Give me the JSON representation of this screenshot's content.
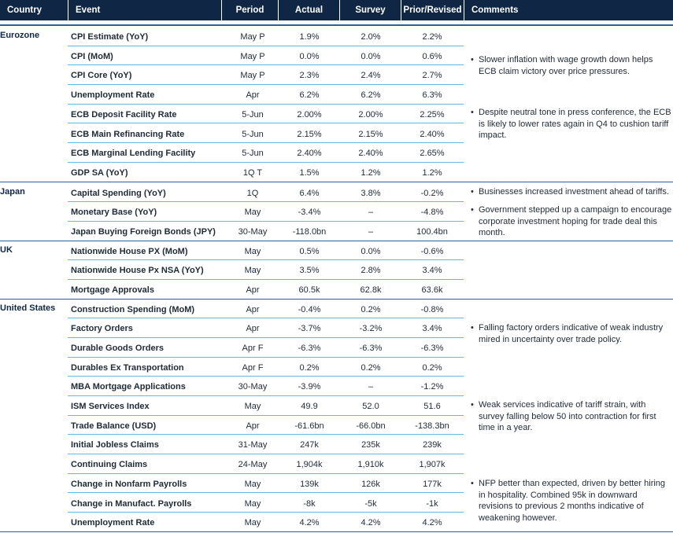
{
  "columns": {
    "country": "Country",
    "event": "Event",
    "period": "Period",
    "actual": "Actual",
    "survey": "Survey",
    "prior": "Prior/Revised",
    "comments": "Comments"
  },
  "bullet_glyph": "•",
  "colors": {
    "header_bg": "#0f2744",
    "row_separator": "#63b8dd",
    "block_border": "#2e5f98"
  },
  "blocks": [
    {
      "country": "Eurozone",
      "rows": [
        {
          "event": "CPI Estimate (YoY)",
          "period": "May P",
          "actual": "1.9%",
          "survey": "2.0%",
          "prior": "2.2%"
        },
        {
          "event": "CPI (MoM)",
          "period": "May P",
          "actual": "0.0%",
          "survey": "0.0%",
          "prior": "0.6%"
        },
        {
          "event": "CPI Core (YoY)",
          "period": "May P",
          "actual": "2.3%",
          "survey": "2.4%",
          "prior": "2.7%"
        },
        {
          "event": "Unemployment Rate",
          "period": "Apr",
          "actual": "6.2%",
          "survey": "6.2%",
          "prior": "6.3%"
        },
        {
          "event": "ECB Deposit Facility Rate",
          "period": "5-Jun",
          "actual": "2.00%",
          "survey": "2.00%",
          "prior": "2.25%"
        },
        {
          "event": "ECB Main Refinancing Rate",
          "period": "5-Jun",
          "actual": "2.15%",
          "survey": "2.15%",
          "prior": "2.40%"
        },
        {
          "event": "ECB Marginal Lending Facility",
          "period": "5-Jun",
          "actual": "2.40%",
          "survey": "2.40%",
          "prior": "2.65%"
        },
        {
          "event": "GDP SA (YoY)",
          "period": "1Q T",
          "actual": "1.5%",
          "survey": "1.2%",
          "prior": "1.2%"
        }
      ],
      "comments": [
        "Slower inflation with wage growth down helps ECB claim victory over price pressures.",
        "Despite neutral tone in press conference, the ECB is likely to lower rates again in Q4 to cushion tariff impact."
      ]
    },
    {
      "country": "Japan",
      "rows": [
        {
          "event": "Capital Spending (YoY)",
          "period": "1Q",
          "actual": "6.4%",
          "survey": "3.8%",
          "prior": "-0.2%"
        },
        {
          "event": "Monetary Base (YoY)",
          "period": "May",
          "actual": "-3.4%",
          "survey": "–",
          "prior": "-4.8%"
        },
        {
          "event": "Japan Buying Foreign Bonds (JPY)",
          "period": "30-May",
          "actual": "-118.0bn",
          "survey": "–",
          "prior": "100.4bn"
        }
      ],
      "comments": [
        "Businesses increased investment ahead of tariffs.",
        "Government stepped up a campaign to encourage corporate investment hoping for trade deal this month."
      ]
    },
    {
      "country": "UK",
      "rows": [
        {
          "event": "Nationwide House PX (MoM)",
          "period": "May",
          "actual": "0.5%",
          "survey": "0.0%",
          "prior": "-0.6%"
        },
        {
          "event": "Nationwide House Px NSA (YoY)",
          "period": "May",
          "actual": "3.5%",
          "survey": "2.8%",
          "prior": "3.4%"
        },
        {
          "event": "Mortgage Approvals",
          "period": "Apr",
          "actual": "60.5k",
          "survey": "62.8k",
          "prior": "63.6k"
        }
      ],
      "comments": []
    },
    {
      "country": "United States",
      "rows": [
        {
          "event": "Construction Spending (MoM)",
          "period": "Apr",
          "actual": "-0.4%",
          "survey": "0.2%",
          "prior": "-0.8%"
        },
        {
          "event": "Factory Orders",
          "period": "Apr",
          "actual": "-3.7%",
          "survey": "-3.2%",
          "prior": "3.4%"
        },
        {
          "event": "Durable Goods Orders",
          "period": "Apr F",
          "actual": "-6.3%",
          "survey": "-6.3%",
          "prior": "-6.3%"
        },
        {
          "event": "Durables Ex Transportation",
          "period": "Apr F",
          "actual": "0.2%",
          "survey": "0.2%",
          "prior": "0.2%"
        },
        {
          "event": "MBA Mortgage Applications",
          "period": "30-May",
          "actual": "-3.9%",
          "survey": "–",
          "prior": "-1.2%"
        },
        {
          "event": "ISM Services Index",
          "period": "May",
          "actual": "49.9",
          "survey": "52.0",
          "prior": "51.6"
        },
        {
          "event": "Trade Balance (USD)",
          "period": "Apr",
          "actual": "-61.6bn",
          "survey": "-66.0bn",
          "prior": "-138.3bn"
        },
        {
          "event": "Initial Jobless Claims",
          "period": "31-May",
          "actual": "247k",
          "survey": "235k",
          "prior": "239k"
        },
        {
          "event": "Continuing Claims",
          "period": "24-May",
          "actual": "1,904k",
          "survey": "1,910k",
          "prior": "1,907k"
        },
        {
          "event": "Change in Nonfarm Payrolls",
          "period": "May",
          "actual": "139k",
          "survey": "126k",
          "prior": "177k"
        },
        {
          "event": "Change in Manufact. Payrolls",
          "period": "May",
          "actual": "-8k",
          "survey": "-5k",
          "prior": "-1k"
        },
        {
          "event": "Unemployment Rate",
          "period": "May",
          "actual": "4.2%",
          "survey": "4.2%",
          "prior": "4.2%"
        }
      ],
      "comments": [
        "Falling factory orders indicative of weak industry mired in uncertainty over trade policy.",
        "Weak services indicative of tariff strain, with survey falling below 50 into contraction for first time in a year.",
        "NFP better than expected, driven by better hiring in hospitality. Combined 95k in downward revisions to previous 2 months indicative of weakening however."
      ]
    }
  ]
}
